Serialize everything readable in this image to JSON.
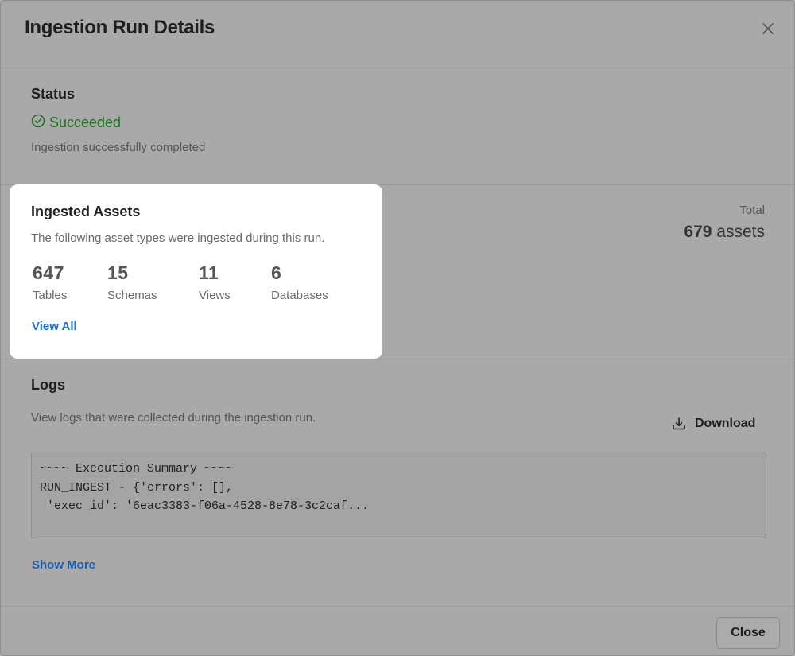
{
  "modal": {
    "title": "Ingestion Run Details"
  },
  "status": {
    "heading": "Status",
    "value": "Succeeded",
    "description": "Ingestion successfully completed",
    "color": "#1f6f1f"
  },
  "ingested": {
    "heading": "Ingested Assets",
    "description": "The following asset types were ingested during this run.",
    "stats": [
      {
        "count": "647",
        "label": "Tables"
      },
      {
        "count": "15",
        "label": "Schemas"
      },
      {
        "count": "11",
        "label": "Views"
      },
      {
        "count": "6",
        "label": "Databases"
      }
    ],
    "view_all": "View All",
    "total_label": "Total",
    "total_count": "679",
    "total_unit": "assets"
  },
  "logs": {
    "heading": "Logs",
    "description": "View logs that were collected during the ingestion run.",
    "download_label": "Download",
    "lines": [
      "~~~~ Execution Summary ~~~~",
      "",
      "RUN_INGEST - {'errors': [],",
      " 'exec_id': '6eac3383-f06a-4528-8e78-3c2caf..."
    ],
    "show_more": "Show More"
  },
  "footer": {
    "close_label": "Close"
  },
  "colors": {
    "link": "#1a6fd6",
    "overlay": "#a9a9a9"
  }
}
